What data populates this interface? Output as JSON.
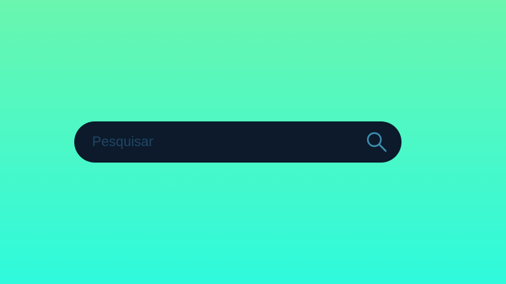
{
  "search": {
    "placeholder": "Pesquisar",
    "value": "",
    "icon": "search-icon"
  },
  "colors": {
    "background_top": "#6af6ae",
    "background_bottom": "#2efadc",
    "bar": "#0c1a2b",
    "placeholder": "#1f4766",
    "icon": "#3d8fb0"
  }
}
